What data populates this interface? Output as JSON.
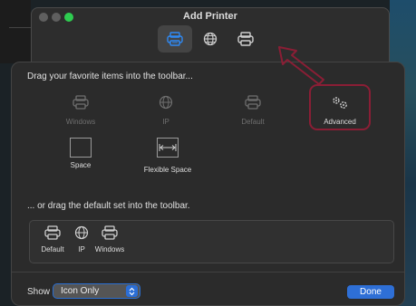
{
  "window": {
    "title": "Add Printer"
  },
  "toolbar": {
    "items": [
      {
        "name": "Default",
        "icon": "printer-icon",
        "selected": true
      },
      {
        "name": "IP",
        "icon": "globe-icon",
        "selected": false
      },
      {
        "name": "Windows",
        "icon": "printer-icon",
        "selected": false
      }
    ]
  },
  "customize": {
    "instruction": "Drag your favorite items into the toolbar...",
    "palette": [
      {
        "label": "Windows",
        "icon": "printer-icon",
        "enabled": false
      },
      {
        "label": "IP",
        "icon": "globe-icon",
        "enabled": false
      },
      {
        "label": "Default",
        "icon": "printer-icon",
        "enabled": false
      },
      {
        "label": "Advanced",
        "icon": "gears-icon",
        "enabled": true
      },
      {
        "label": "Space",
        "icon": "space-box",
        "enabled": true
      },
      {
        "label": "Flexible Space",
        "icon": "flexible-space-box",
        "enabled": true
      }
    ],
    "default_set_instruction": "... or drag the default set into the toolbar.",
    "default_set": [
      {
        "label": "Default",
        "icon": "printer-icon"
      },
      {
        "label": "IP",
        "icon": "globe-icon"
      },
      {
        "label": "Windows",
        "icon": "printer-icon"
      }
    ],
    "show_label": "Show",
    "show_value": "Icon Only",
    "done_label": "Done"
  },
  "colors": {
    "accent": "#2e6fd6",
    "annotation": "#8a1e35",
    "traffic_zoom": "#2ecc50"
  }
}
